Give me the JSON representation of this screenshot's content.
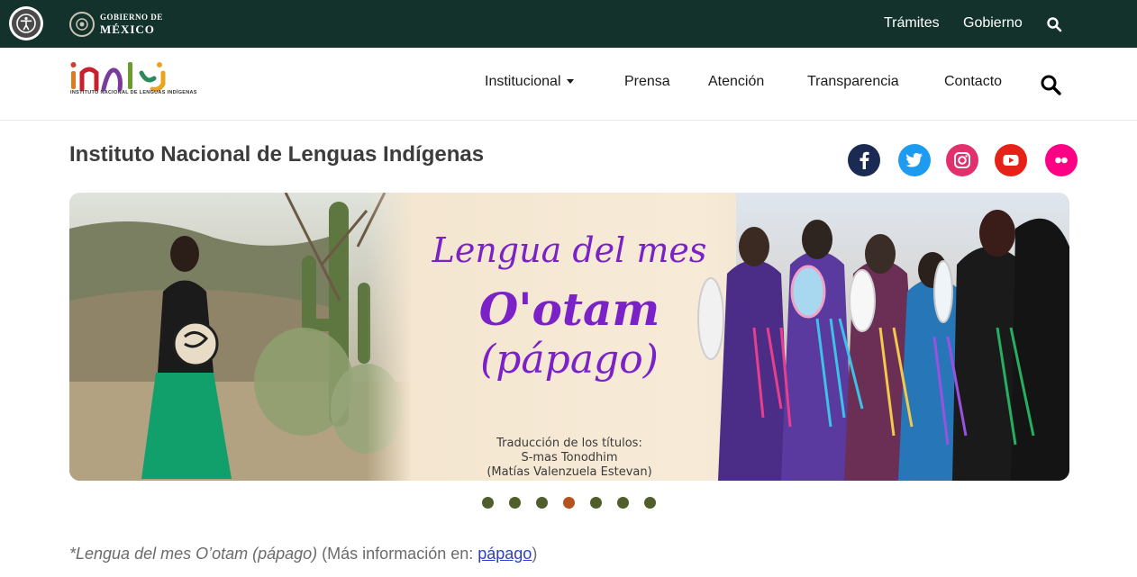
{
  "gov_bar": {
    "logo_line1": "GOBIERNO DE",
    "logo_line2": "MÉXICO",
    "links": [
      "Trámites",
      "Gobierno"
    ],
    "icons": [
      "accessibility-icon",
      "search-icon"
    ]
  },
  "navbar": {
    "logo_subtitle": "INSTITUTO NACIONAL DE LENGUAS INDÍGENAS",
    "items": [
      "Institucional",
      "Prensa",
      "Atención",
      "Transparencia",
      "Contacto"
    ],
    "search_icon": "search-icon"
  },
  "page": {
    "title": "Instituto Nacional de Lenguas Indígenas",
    "social": [
      "facebook-icon",
      "twitter-icon",
      "instagram-icon",
      "youtube-icon",
      "flickr-icon"
    ],
    "social_colors": [
      "#1a2a52",
      "#1d9bf0",
      "#e1306c",
      "#e62117",
      "#ff0084"
    ]
  },
  "banner": {
    "line1": "Lengua del mes",
    "line2": "O'otam",
    "line3": "(pápago)",
    "credit1": "Traducción de los títulos:",
    "credit2": "S-mas Tonodhim",
    "credit3": "(Matías Valenzuela Estevan)",
    "text_color": "#7a22c8"
  },
  "carousel": {
    "slide_count": 7,
    "active_index": 3
  },
  "caption": {
    "italic": "*Lengua del mes O’otam (pápago)",
    "prefix": " (Más información en: ",
    "link": "pápago",
    "suffix": ")"
  }
}
